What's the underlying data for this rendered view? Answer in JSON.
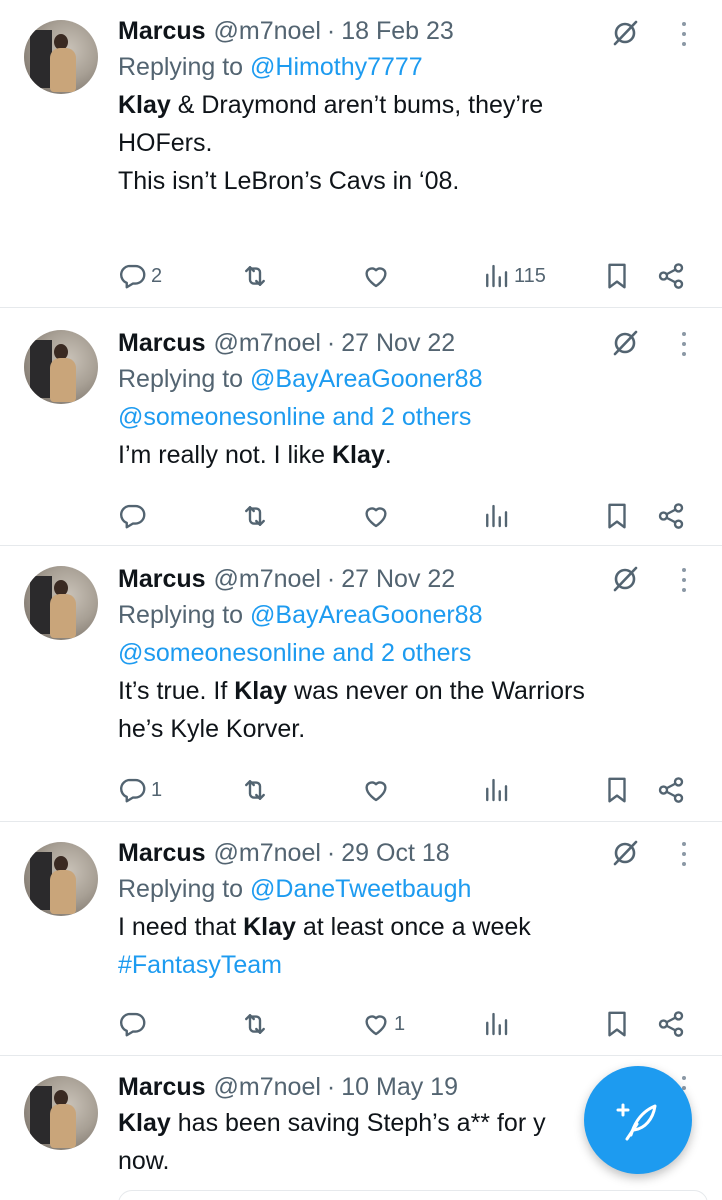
{
  "colors": {
    "accent": "#1d9bf0",
    "muted": "#536471",
    "text": "#0f1419"
  },
  "tweets": [
    {
      "name": "Marcus",
      "handle": "@m7noel",
      "sep": "·",
      "date": "18 Feb 23",
      "replying_prefix": "Replying to ",
      "replying_to": "@Himothy7777",
      "replying_extra": "",
      "lines": [
        {
          "bold": "Klay",
          "rest": " & Draymond aren’t bums, they’re"
        },
        {
          "bold": "",
          "rest": "HOFers."
        },
        {
          "bold": "",
          "rest": " "
        },
        {
          "bold": "",
          "rest": "This isn’t LeBron’s Cavs in ‘08."
        }
      ],
      "reply_count": "2",
      "retweet_count": "",
      "like_count": "",
      "view_count": "115"
    },
    {
      "name": "Marcus",
      "handle": "@m7noel",
      "sep": "·",
      "date": "27 Nov 22",
      "replying_prefix": "Replying to ",
      "replying_to": "@BayAreaGooner88",
      "replying_extra": "@someonesonline and 2 others",
      "line_prefix": "I’m really not. I like ",
      "line_bold": "Klay",
      "line_suffix": ".",
      "reply_count": "",
      "retweet_count": "",
      "like_count": "",
      "view_count": ""
    },
    {
      "name": "Marcus",
      "handle": "@m7noel",
      "sep": "·",
      "date": "27 Nov 22",
      "replying_prefix": "Replying to ",
      "replying_to": "@BayAreaGooner88",
      "replying_extra": "@someonesonline and 2 others",
      "line_prefix": "It’s true. If ",
      "line_bold": "Klay",
      "line_suffix": " was never on the Warriors",
      "line2": "he’s Kyle Korver.",
      "reply_count": "1",
      "retweet_count": "",
      "like_count": "",
      "view_count": ""
    },
    {
      "name": "Marcus",
      "handle": "@m7noel",
      "sep": "·",
      "date": "29 Oct 18",
      "replying_prefix": "Replying to ",
      "replying_to": "@DaneTweetbaugh",
      "line_prefix": "I need that ",
      "line_bold": "Klay",
      "line_suffix": " at least once a week",
      "hashtag": "#FantasyTeam",
      "reply_count": "",
      "retweet_count": "",
      "like_count": "1",
      "view_count": ""
    },
    {
      "name": "Marcus",
      "handle": "@m7noel",
      "sep": "·",
      "date": "10 May 19",
      "line_bold": "Klay",
      "line_suffix": " has been saving Steph’s a** for y",
      "line2": "now."
    }
  ],
  "compose_button": {
    "icon": "feather-plus-icon"
  }
}
